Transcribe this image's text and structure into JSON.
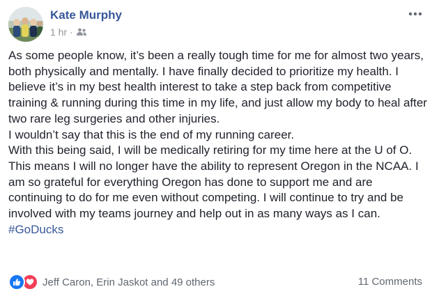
{
  "post": {
    "author": "Kate Murphy",
    "time": "1 hr",
    "separator": "·",
    "audience_icon": "friends-icon",
    "more_icon": "more-horizontal-icon",
    "paragraphs": [
      "As some people know, it’s been a really tough time for me for almost two years, both physically and mentally. I have finally decided to prioritize my health. I believe it’s in my best health interest to take a step back from competitive training & running during this time in my life, and just allow my body to heal after two rare leg surgeries and other injuries.",
      "I wouldn’t say that this is the end of my running career.",
      "With this being said, I will be medically retiring for my time here at the U of O. This means I will no longer have the ability to represent Oregon in the NCAA. I am so grateful for everything Oregon has done to support me and are continuing to do for me even without competing. I will continue to try and be involved with my teams journey and help out in as many ways as I can."
    ],
    "hashtag": "#GoDucks"
  },
  "reactions": {
    "icons": [
      "like-icon",
      "love-icon"
    ],
    "names": "Jeff Caron, Erin Jaskot and 49 others",
    "like_color": "#1877f2",
    "love_color": "#f33e58"
  },
  "comments": {
    "label": "11 Comments"
  },
  "colors": {
    "author_link": "#365899",
    "body_text": "#1d2129",
    "meta_text": "#90949c",
    "footer_text": "#606770"
  }
}
